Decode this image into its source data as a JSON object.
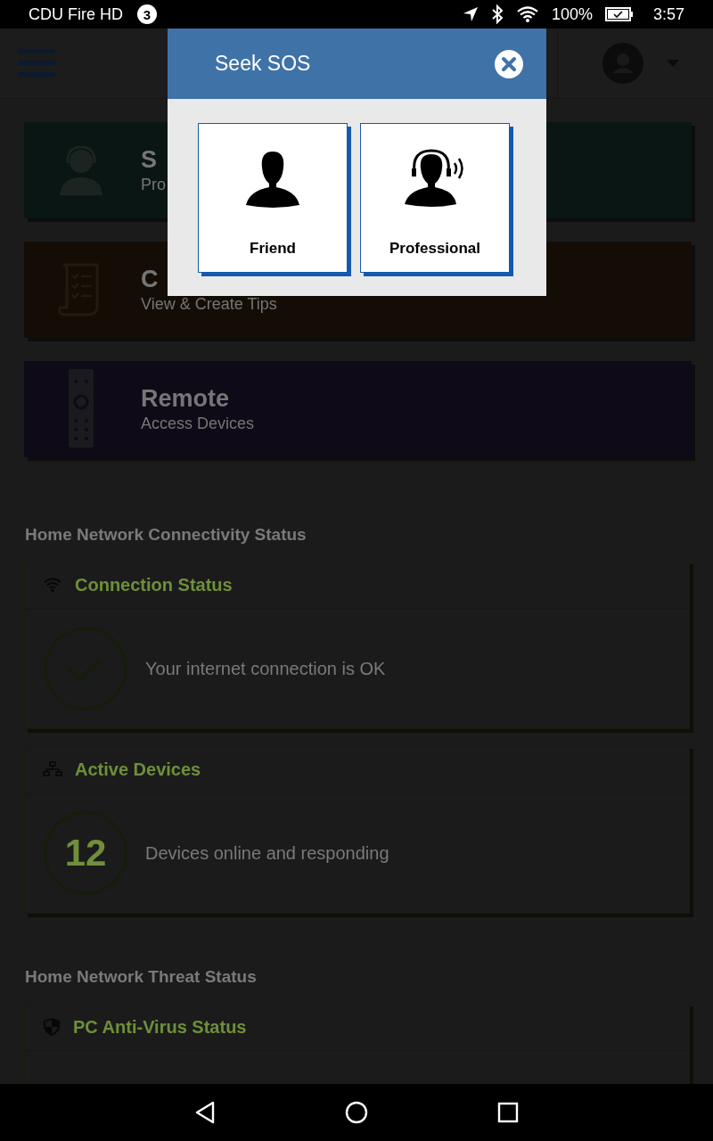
{
  "status_bar": {
    "device": "CDU Fire HD",
    "notification_count": "3",
    "battery": "100%",
    "time": "3:57"
  },
  "dialog": {
    "title": "Seek SOS",
    "options": [
      {
        "label": "Friend",
        "kind": "person"
      },
      {
        "label": "Professional",
        "kind": "headset"
      }
    ]
  },
  "tiles": [
    {
      "title": "S",
      "subtitle": "Pro",
      "kind": "sos",
      "color": "#0a1614"
    },
    {
      "title": "C",
      "subtitle": "View & Create Tips",
      "kind": "checklist",
      "color": "#140d06"
    },
    {
      "title": "Remote",
      "subtitle": "Access Devices",
      "kind": "remote",
      "color": "#0e0a17"
    }
  ],
  "connectivity": {
    "heading": "Home Network Connectivity Status",
    "cards": [
      {
        "title": "Connection Status",
        "kind": "check",
        "message": "Your internet connection is OK"
      },
      {
        "title": "Active Devices",
        "kind": "count",
        "count": "12",
        "message": "Devices online and responding"
      }
    ]
  },
  "threat": {
    "heading": "Home Network Threat Status",
    "cards": [
      {
        "title": "PC Anti-Virus Status",
        "kind": "shield"
      }
    ]
  }
}
